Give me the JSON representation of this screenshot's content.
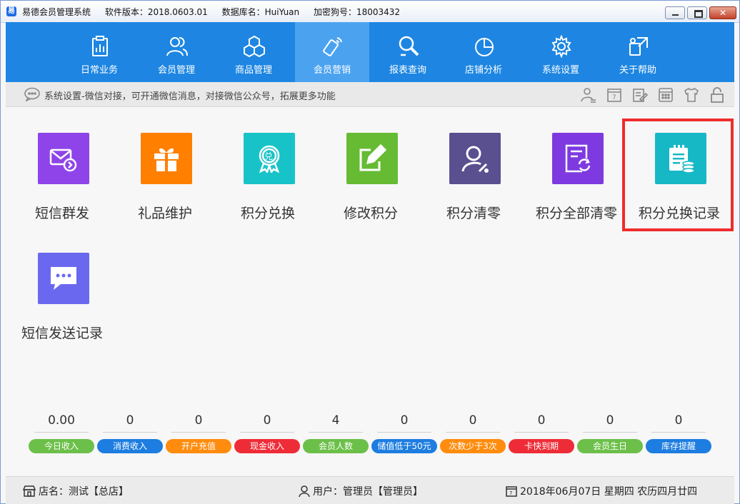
{
  "titlebar": {
    "app_name": "易德会员管理系统",
    "version": "软件版本：2018.0603.01",
    "database": "数据库名：HuiYuan",
    "dongle": "加密狗号：18003432"
  },
  "nav": {
    "items": [
      {
        "label": "日常业务",
        "icon": "clipboard-chart-icon"
      },
      {
        "label": "会员管理",
        "icon": "users-icon"
      },
      {
        "label": "商品管理",
        "icon": "cubes-icon"
      },
      {
        "label": "会员营销",
        "icon": "phone-signal-icon"
      },
      {
        "label": "报表查询",
        "icon": "search-report-icon"
      },
      {
        "label": "店铺分析",
        "icon": "pie-chart-icon"
      },
      {
        "label": "系统设置",
        "icon": "gear-icon"
      },
      {
        "label": "关于帮助",
        "icon": "help-icon"
      }
    ],
    "active_index": 3
  },
  "hint": {
    "text": "系统设置-微信对接，可开通微信消息，对接微信公众号，拓展更多功能"
  },
  "functions": [
    {
      "label": "短信群发",
      "color": "#8e44e8",
      "icon": "sms-broadcast-icon"
    },
    {
      "label": "礼品维护",
      "color": "#ff7f00",
      "icon": "gift-icon"
    },
    {
      "label": "积分兑换",
      "color": "#18c3c8",
      "icon": "points-badge-icon"
    },
    {
      "label": "修改积分",
      "color": "#66bb33",
      "icon": "edit-icon"
    },
    {
      "label": "积分清零",
      "color": "#5a4f8f",
      "icon": "user-clear-icon"
    },
    {
      "label": "积分全部清零",
      "color": "#7e3ae0",
      "icon": "refresh-document-icon"
    },
    {
      "label": "积分兑换记录",
      "color": "#17b8c6",
      "icon": "notebook-coins-icon"
    },
    {
      "label": "短信发送记录",
      "color": "#6b68f0",
      "icon": "chat-bubble-icon"
    }
  ],
  "stats": [
    {
      "value": "0.00",
      "label": "今日收入",
      "color": "#6cc04a"
    },
    {
      "value": "0",
      "label": "消费收入",
      "color": "#1d7de0"
    },
    {
      "value": "0",
      "label": "开户充值",
      "color": "#ff8c0e"
    },
    {
      "value": "0",
      "label": "现金收入",
      "color": "#ee2c37"
    },
    {
      "value": "4",
      "label": "会员人数",
      "color": "#6cc04a"
    },
    {
      "value": "0",
      "label": "储值低于50元",
      "color": "#1d7de0"
    },
    {
      "value": "0",
      "label": "次数少于3次",
      "color": "#ff8c0e"
    },
    {
      "value": "0",
      "label": "卡快到期",
      "color": "#ee2c37"
    },
    {
      "value": "0",
      "label": "会员生日",
      "color": "#6cc04a"
    },
    {
      "value": "0",
      "label": "库存提醒",
      "color": "#1d7de0"
    }
  ],
  "status": {
    "store": "店名：测试【总店】",
    "user": "用户：管理员【管理员】",
    "date": "2018年06月07日 星期四 农历四月廿四"
  }
}
